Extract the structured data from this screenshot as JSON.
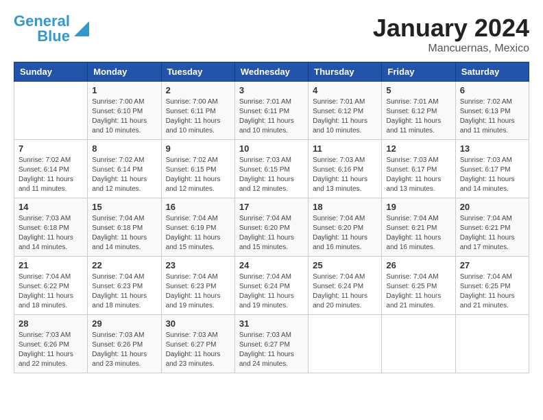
{
  "logo": {
    "line1": "General",
    "line2": "Blue"
  },
  "title": "January 2024",
  "location": "Mancuernas, Mexico",
  "days_of_week": [
    "Sunday",
    "Monday",
    "Tuesday",
    "Wednesday",
    "Thursday",
    "Friday",
    "Saturday"
  ],
  "weeks": [
    [
      {
        "num": "",
        "info": ""
      },
      {
        "num": "1",
        "info": "Sunrise: 7:00 AM\nSunset: 6:10 PM\nDaylight: 11 hours\nand 10 minutes."
      },
      {
        "num": "2",
        "info": "Sunrise: 7:00 AM\nSunset: 6:11 PM\nDaylight: 11 hours\nand 10 minutes."
      },
      {
        "num": "3",
        "info": "Sunrise: 7:01 AM\nSunset: 6:11 PM\nDaylight: 11 hours\nand 10 minutes."
      },
      {
        "num": "4",
        "info": "Sunrise: 7:01 AM\nSunset: 6:12 PM\nDaylight: 11 hours\nand 10 minutes."
      },
      {
        "num": "5",
        "info": "Sunrise: 7:01 AM\nSunset: 6:12 PM\nDaylight: 11 hours\nand 11 minutes."
      },
      {
        "num": "6",
        "info": "Sunrise: 7:02 AM\nSunset: 6:13 PM\nDaylight: 11 hours\nand 11 minutes."
      }
    ],
    [
      {
        "num": "7",
        "info": "Sunrise: 7:02 AM\nSunset: 6:14 PM\nDaylight: 11 hours\nand 11 minutes."
      },
      {
        "num": "8",
        "info": "Sunrise: 7:02 AM\nSunset: 6:14 PM\nDaylight: 11 hours\nand 12 minutes."
      },
      {
        "num": "9",
        "info": "Sunrise: 7:02 AM\nSunset: 6:15 PM\nDaylight: 11 hours\nand 12 minutes."
      },
      {
        "num": "10",
        "info": "Sunrise: 7:03 AM\nSunset: 6:15 PM\nDaylight: 11 hours\nand 12 minutes."
      },
      {
        "num": "11",
        "info": "Sunrise: 7:03 AM\nSunset: 6:16 PM\nDaylight: 11 hours\nand 13 minutes."
      },
      {
        "num": "12",
        "info": "Sunrise: 7:03 AM\nSunset: 6:17 PM\nDaylight: 11 hours\nand 13 minutes."
      },
      {
        "num": "13",
        "info": "Sunrise: 7:03 AM\nSunset: 6:17 PM\nDaylight: 11 hours\nand 14 minutes."
      }
    ],
    [
      {
        "num": "14",
        "info": "Sunrise: 7:03 AM\nSunset: 6:18 PM\nDaylight: 11 hours\nand 14 minutes."
      },
      {
        "num": "15",
        "info": "Sunrise: 7:04 AM\nSunset: 6:18 PM\nDaylight: 11 hours\nand 14 minutes."
      },
      {
        "num": "16",
        "info": "Sunrise: 7:04 AM\nSunset: 6:19 PM\nDaylight: 11 hours\nand 15 minutes."
      },
      {
        "num": "17",
        "info": "Sunrise: 7:04 AM\nSunset: 6:20 PM\nDaylight: 11 hours\nand 15 minutes."
      },
      {
        "num": "18",
        "info": "Sunrise: 7:04 AM\nSunset: 6:20 PM\nDaylight: 11 hours\nand 16 minutes."
      },
      {
        "num": "19",
        "info": "Sunrise: 7:04 AM\nSunset: 6:21 PM\nDaylight: 11 hours\nand 16 minutes."
      },
      {
        "num": "20",
        "info": "Sunrise: 7:04 AM\nSunset: 6:21 PM\nDaylight: 11 hours\nand 17 minutes."
      }
    ],
    [
      {
        "num": "21",
        "info": "Sunrise: 7:04 AM\nSunset: 6:22 PM\nDaylight: 11 hours\nand 18 minutes."
      },
      {
        "num": "22",
        "info": "Sunrise: 7:04 AM\nSunset: 6:23 PM\nDaylight: 11 hours\nand 18 minutes."
      },
      {
        "num": "23",
        "info": "Sunrise: 7:04 AM\nSunset: 6:23 PM\nDaylight: 11 hours\nand 19 minutes."
      },
      {
        "num": "24",
        "info": "Sunrise: 7:04 AM\nSunset: 6:24 PM\nDaylight: 11 hours\nand 19 minutes."
      },
      {
        "num": "25",
        "info": "Sunrise: 7:04 AM\nSunset: 6:24 PM\nDaylight: 11 hours\nand 20 minutes."
      },
      {
        "num": "26",
        "info": "Sunrise: 7:04 AM\nSunset: 6:25 PM\nDaylight: 11 hours\nand 21 minutes."
      },
      {
        "num": "27",
        "info": "Sunrise: 7:04 AM\nSunset: 6:25 PM\nDaylight: 11 hours\nand 21 minutes."
      }
    ],
    [
      {
        "num": "28",
        "info": "Sunrise: 7:03 AM\nSunset: 6:26 PM\nDaylight: 11 hours\nand 22 minutes."
      },
      {
        "num": "29",
        "info": "Sunrise: 7:03 AM\nSunset: 6:26 PM\nDaylight: 11 hours\nand 23 minutes."
      },
      {
        "num": "30",
        "info": "Sunrise: 7:03 AM\nSunset: 6:27 PM\nDaylight: 11 hours\nand 23 minutes."
      },
      {
        "num": "31",
        "info": "Sunrise: 7:03 AM\nSunset: 6:27 PM\nDaylight: 11 hours\nand 24 minutes."
      },
      {
        "num": "",
        "info": ""
      },
      {
        "num": "",
        "info": ""
      },
      {
        "num": "",
        "info": ""
      }
    ]
  ]
}
